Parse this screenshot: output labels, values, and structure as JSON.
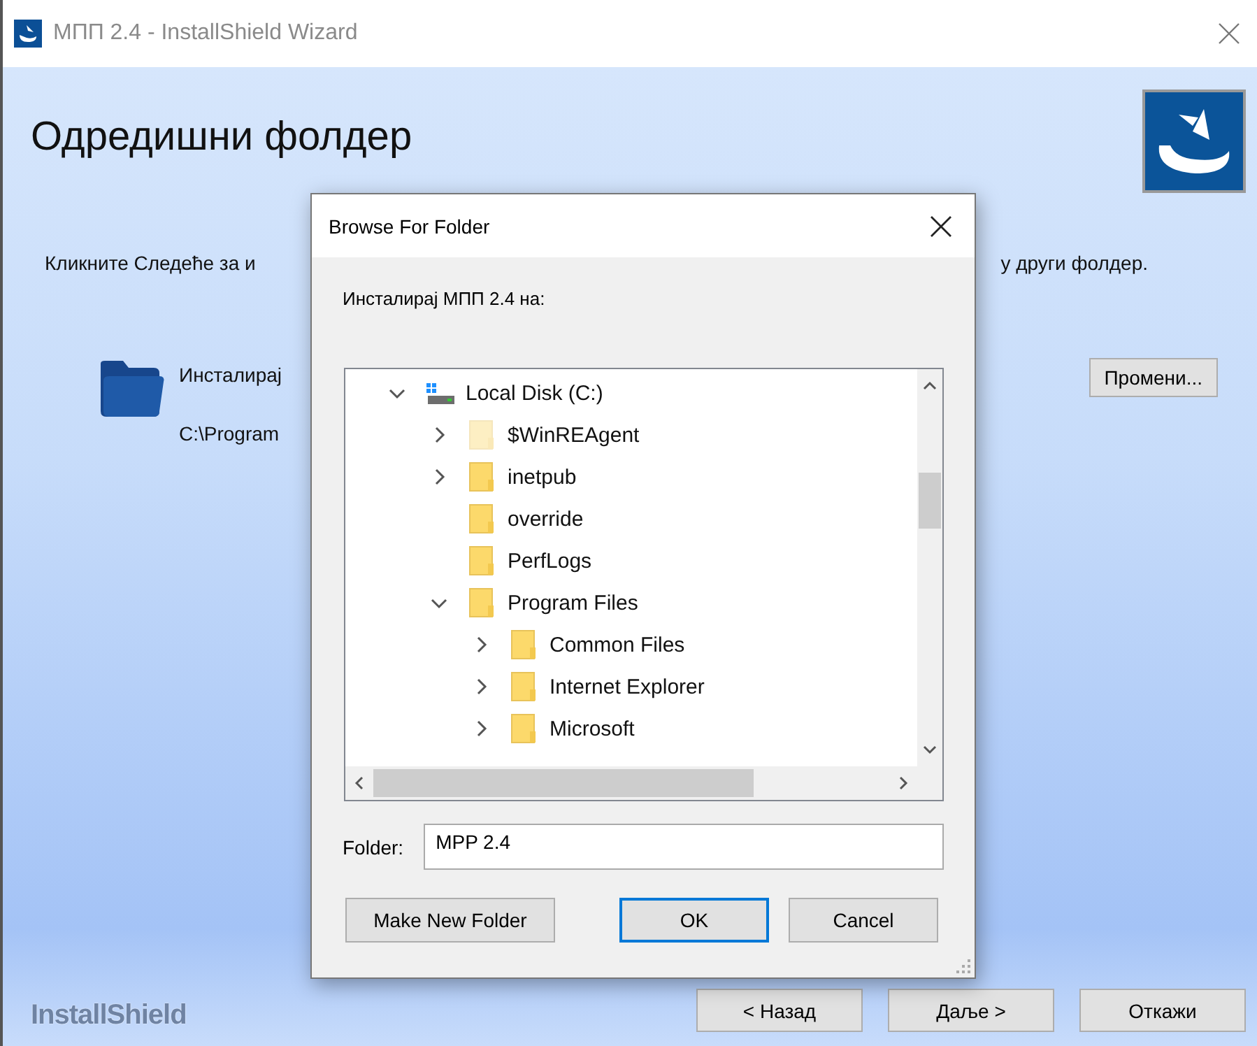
{
  "window": {
    "title": "МПП 2.4 - InstallShield Wizard"
  },
  "page": {
    "heading": "Одредишни фолдер",
    "instruction_left": "Кликните Следеће за и",
    "instruction_right": "у други фолдер.",
    "install_label": "Инсталирај",
    "install_path": "C:\\Program",
    "change_button": {
      "label": "Промени..."
    }
  },
  "brand": "InstallShield",
  "buttons": [
    {
      "label": "< Назад"
    },
    {
      "label": "Даље >"
    },
    {
      "label": "Откажи"
    }
  ],
  "dialog": {
    "title": "Browse For Folder",
    "prompt": "Инсталирај МПП 2.4 на:",
    "tree": [
      {
        "kind": "drive",
        "label": "Local Disk (C:)",
        "expandable": true,
        "expanded": true,
        "hidden": false,
        "children": [
          {
            "kind": "folder",
            "label": "$WinREAgent",
            "expandable": true,
            "expanded": false,
            "hidden": true
          },
          {
            "kind": "folder",
            "label": "inetpub",
            "expandable": true,
            "expanded": false,
            "hidden": false
          },
          {
            "kind": "folder",
            "label": "override",
            "expandable": false,
            "expanded": false,
            "hidden": false
          },
          {
            "kind": "folder",
            "label": "PerfLogs",
            "expandable": false,
            "expanded": false,
            "hidden": false
          },
          {
            "kind": "folder",
            "label": "Program Files",
            "expandable": true,
            "expanded": true,
            "hidden": false,
            "children": [
              {
                "kind": "folder",
                "label": "Common Files",
                "expandable": true,
                "expanded": false,
                "hidden": false
              },
              {
                "kind": "folder",
                "label": "Internet Explorer",
                "expandable": true,
                "expanded": false,
                "hidden": false
              },
              {
                "kind": "folder",
                "label": "Microsoft",
                "expandable": true,
                "expanded": false,
                "hidden": false
              }
            ]
          }
        ]
      }
    ],
    "folder_label": "Folder:",
    "folder_value": "MPP 2.4",
    "buttons": [
      {
        "label": "Make New Folder",
        "default": false
      },
      {
        "label": "OK",
        "default": true
      },
      {
        "label": "Cancel",
        "default": false
      }
    ]
  }
}
